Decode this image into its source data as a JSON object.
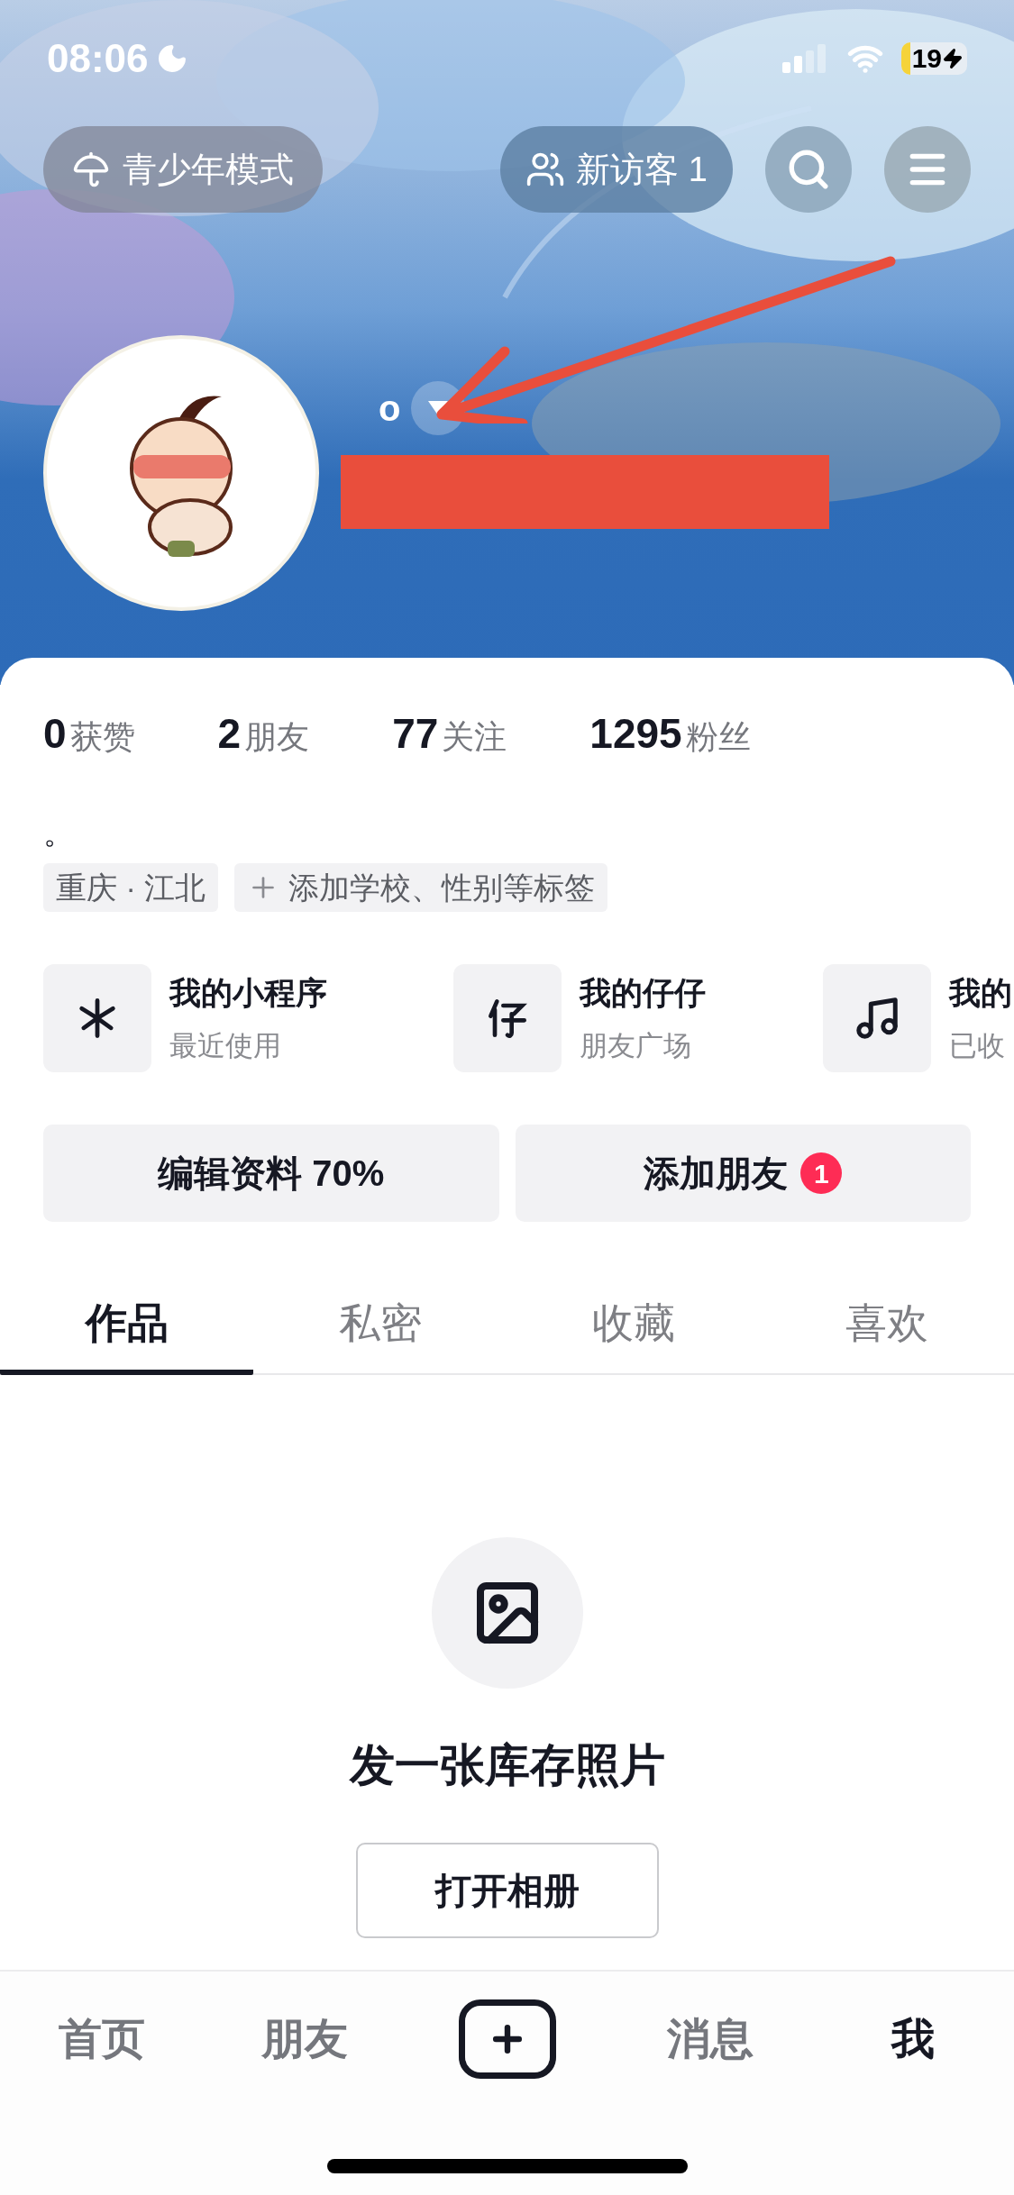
{
  "status_bar": {
    "time": "08:06",
    "battery": "19"
  },
  "top_bar": {
    "teen_mode": "青少年模式",
    "visitors": "新访客 1"
  },
  "profile": {
    "name": "o",
    "stats": [
      {
        "value": "0",
        "label": "获赞"
      },
      {
        "value": "2",
        "label": "朋友"
      },
      {
        "value": "77",
        "label": "关注"
      },
      {
        "value": "1295",
        "label": "粉丝"
      }
    ],
    "bio": "。",
    "tags": [
      {
        "kind": "location",
        "text": "重庆 · 江北"
      },
      {
        "kind": "add",
        "text": "添加学校、性别等标签"
      }
    ]
  },
  "shortcuts": [
    {
      "kind": "mini-program",
      "title": "我的小程序",
      "subtitle": "最近使用"
    },
    {
      "kind": "zaizai",
      "title": "我的仔仔",
      "subtitle": "朋友广场"
    },
    {
      "kind": "music",
      "title": "我的",
      "subtitle": "已收"
    }
  ],
  "actions": [
    {
      "label": "编辑资料 70%"
    },
    {
      "label": "添加朋友",
      "badge": "1"
    }
  ],
  "tabs": [
    {
      "label": "作品",
      "selected": true
    },
    {
      "label": "私密",
      "selected": false
    },
    {
      "label": "收藏",
      "selected": false
    },
    {
      "label": "喜欢",
      "selected": false
    }
  ],
  "empty_state": {
    "message": "发一张库存照片",
    "button": "打开相册"
  },
  "bottom_nav": [
    {
      "kind": "text",
      "label": "首页",
      "selected": false
    },
    {
      "kind": "text",
      "label": "朋友",
      "selected": false
    },
    {
      "kind": "create"
    },
    {
      "kind": "text",
      "label": "消息",
      "selected": false
    },
    {
      "kind": "text",
      "label": "我",
      "selected": true
    }
  ]
}
